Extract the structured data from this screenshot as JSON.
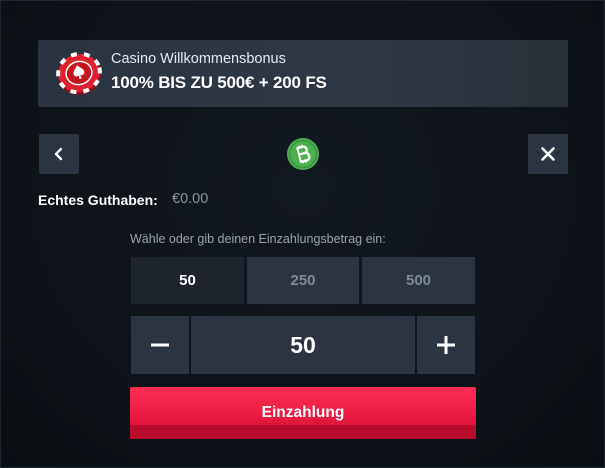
{
  "banner": {
    "subtitle": "Casino Willkommensbonus",
    "title": "100% BIS ZU 500€ + 200 FS",
    "icon": "casino-chip-icon"
  },
  "nav": {
    "prev_icon": "chevron-left-icon",
    "close_icon": "close-icon",
    "currency_icon": "bitcoin-cash-icon"
  },
  "balance": {
    "label": "Echtes Guthaben:",
    "value": "€0.00"
  },
  "deposit": {
    "prompt": "Wähle oder gib deinen Einzahlungsbetrag ein:",
    "options": [
      "50",
      "250",
      "500"
    ],
    "selected": "50",
    "amount": "50",
    "button_label": "Einzahlung"
  },
  "colors": {
    "accent": "#ff2d55",
    "panel": "#2b3441",
    "coin": "#4caf50"
  }
}
